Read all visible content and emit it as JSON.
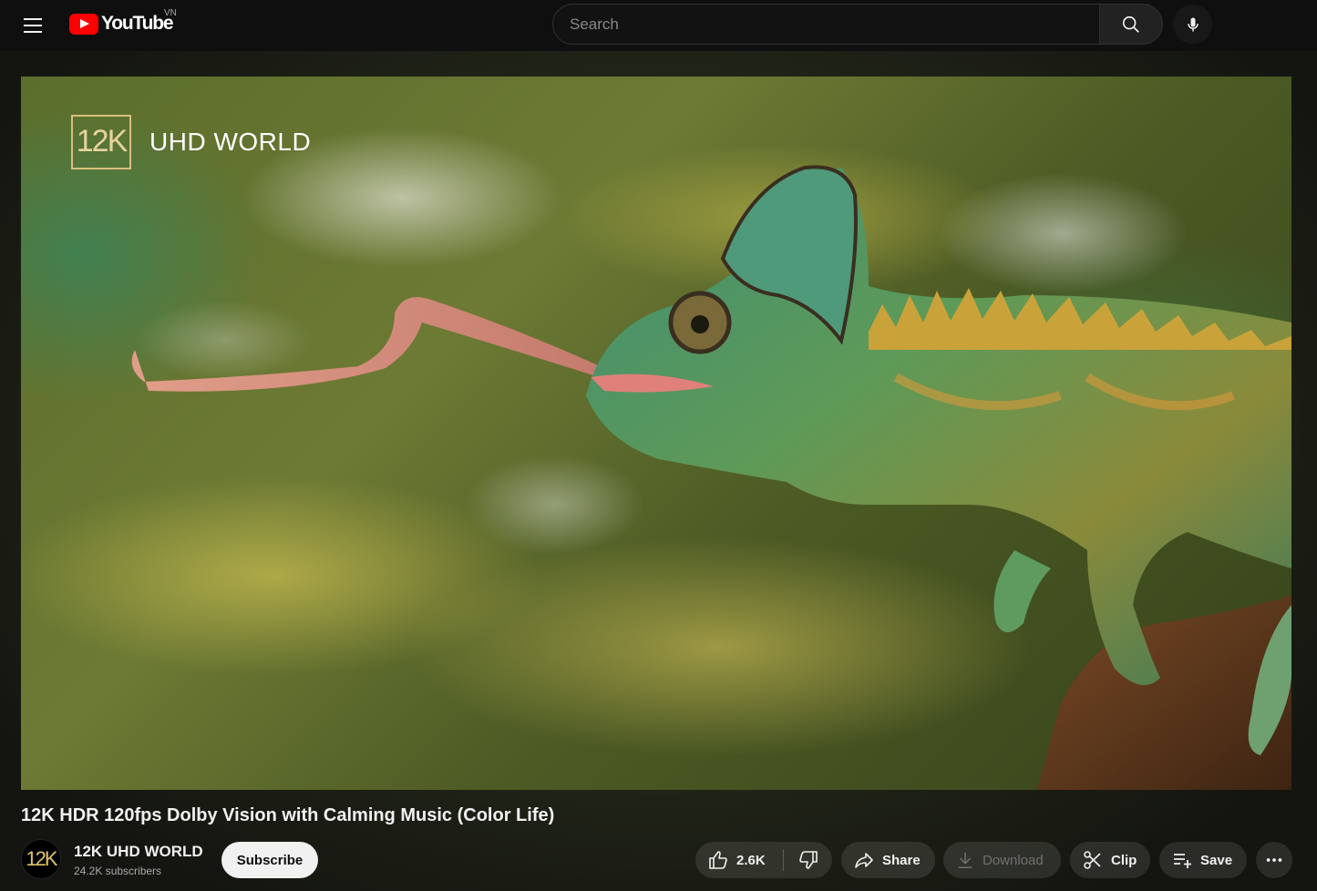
{
  "masthead": {
    "logo_text": "YouTube",
    "country_code": "VN",
    "search_placeholder": "Search"
  },
  "video": {
    "watermark_badge": "12K",
    "watermark_label": "UHD WORLD",
    "title": "12K HDR 120fps Dolby Vision with Calming Music (Color Life)"
  },
  "channel": {
    "avatar_text": "12K",
    "name": "12K UHD WORLD",
    "subscribers": "24.2K subscribers",
    "subscribe_label": "Subscribe"
  },
  "actions": {
    "like_count": "2.6K",
    "share_label": "Share",
    "download_label": "Download",
    "clip_label": "Clip",
    "save_label": "Save"
  },
  "colors": {
    "brand_red": "#ff0000",
    "background": "#0f0f0f",
    "watermark_gold": "#d8bf7a"
  }
}
